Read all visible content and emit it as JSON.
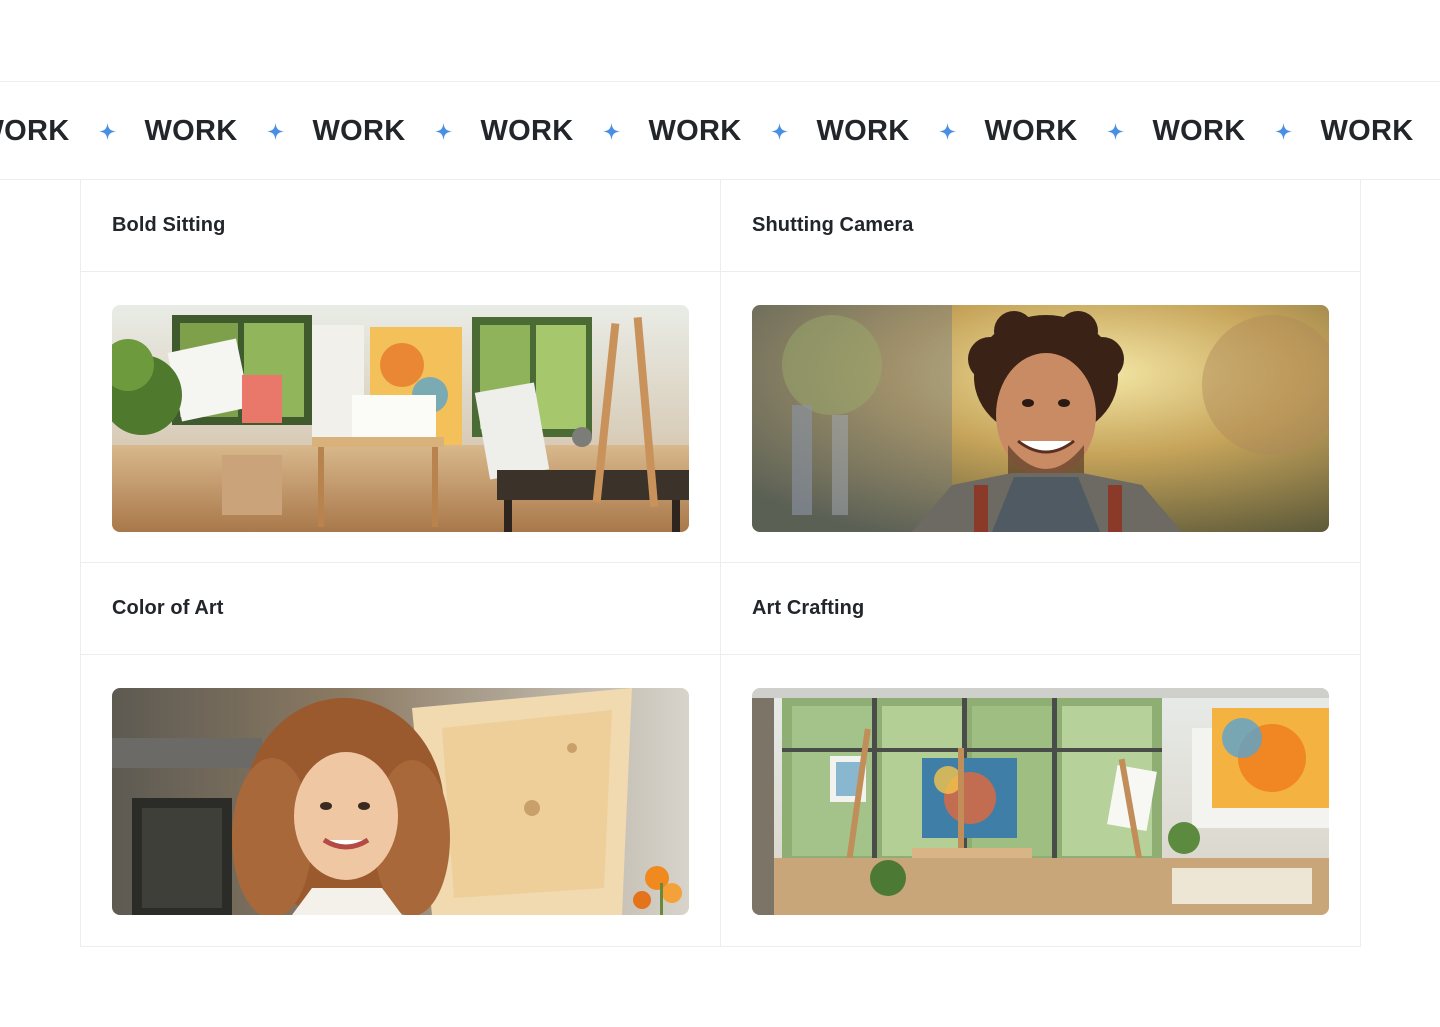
{
  "marquee": {
    "word": "WORK",
    "separator_icon": "four-point-star-icon",
    "accent_color": "#4a90e2",
    "items": [
      "WORK",
      "WORK",
      "WORK",
      "WORK",
      "WORK",
      "WORK",
      "WORK",
      "WORK",
      "WORK"
    ]
  },
  "gallery": {
    "cards": [
      {
        "title": "Bold Sitting",
        "image": "art-studio-interior-photo"
      },
      {
        "title": "Shutting Camera",
        "image": "smiling-curly-haired-man-photo"
      },
      {
        "title": "Color of Art",
        "image": "smiling-woman-with-easel-photo"
      },
      {
        "title": "Art Crafting",
        "image": "bright-art-studio-with-easels-photo"
      }
    ]
  }
}
